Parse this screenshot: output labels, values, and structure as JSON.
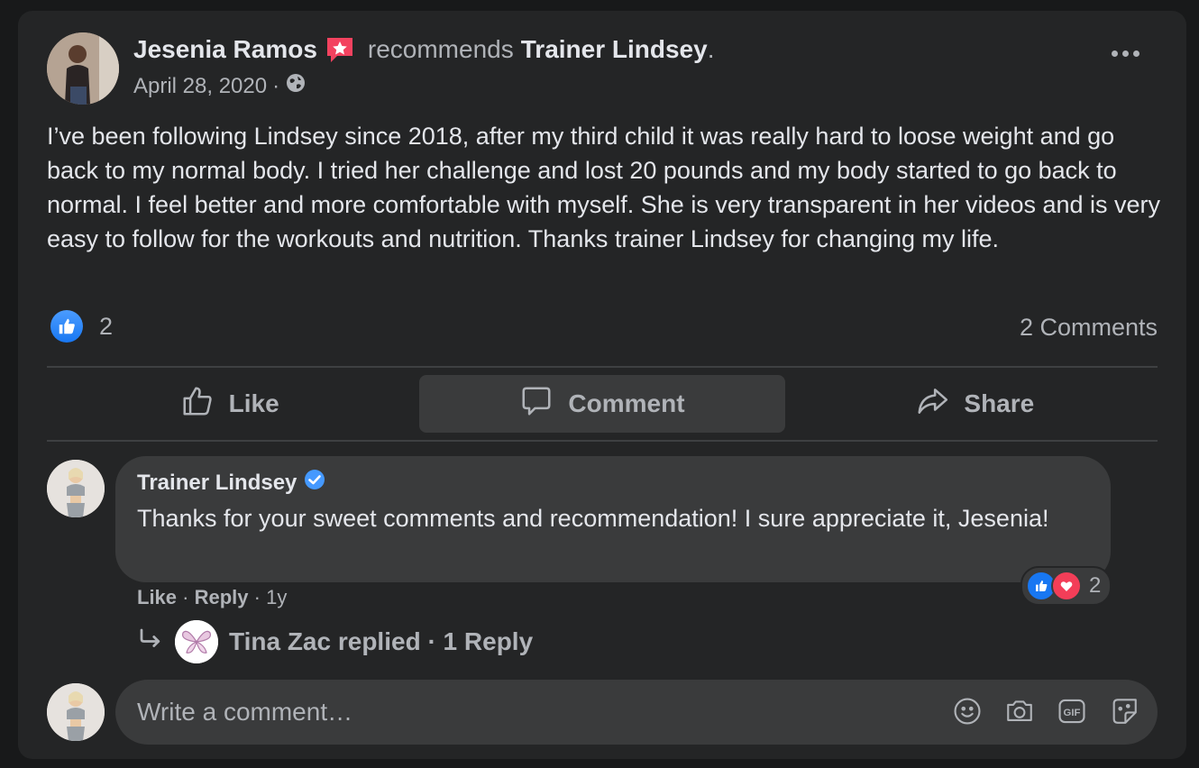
{
  "post": {
    "author": "Jesenia Ramos",
    "recommends": "recommends",
    "target": "Trainer Lindsey",
    "period": ".",
    "date": "April 28, 2020",
    "date_sep": "·",
    "body": "I’ve been following Lindsey since 2018, after my third child it was really hard to loose weight and go back to my normal body. I tried her challenge and lost 20 pounds and my body started to go back to normal. I feel better and more comfortable with myself. She is very transparent in her videos and is very easy to follow for the workouts and nutrition. Thanks trainer Lindsey for changing my life.",
    "like_count": "2",
    "comments_count": "2 Comments"
  },
  "actions": {
    "like": "Like",
    "comment": "Comment",
    "share": "Share"
  },
  "comment": {
    "author": "Trainer Lindsey",
    "text": "Thanks for your sweet comments and recommendation! I sure appreciate it, Jesenia!",
    "reaction_count": "2",
    "like": "Like",
    "reply": "Reply",
    "sep": "·",
    "age": "1y"
  },
  "replies": {
    "text": "Tina Zac replied · 1 Reply"
  },
  "composer": {
    "placeholder": "Write a comment…"
  },
  "colors": {
    "card": "#242526",
    "bubble": "#3a3b3c",
    "text": "#e4e6eb",
    "muted": "#b0b3b8",
    "like_blue": "#1877f2",
    "love_red": "#f33e58",
    "recommend_badge": "#f3425f",
    "verified": "#4599ff"
  },
  "icons": {
    "recommend": "recommend-badge-icon",
    "privacy": "globe-icon",
    "more": "more-icon",
    "like": "thumbs-up-icon",
    "comment": "comment-icon",
    "share": "share-icon",
    "verified": "verified-badge-icon",
    "reply_arrow": "reply-arrow-icon",
    "emoji": "emoji-icon",
    "camera": "camera-icon",
    "gif": "gif-icon",
    "sticker": "sticker-icon"
  }
}
